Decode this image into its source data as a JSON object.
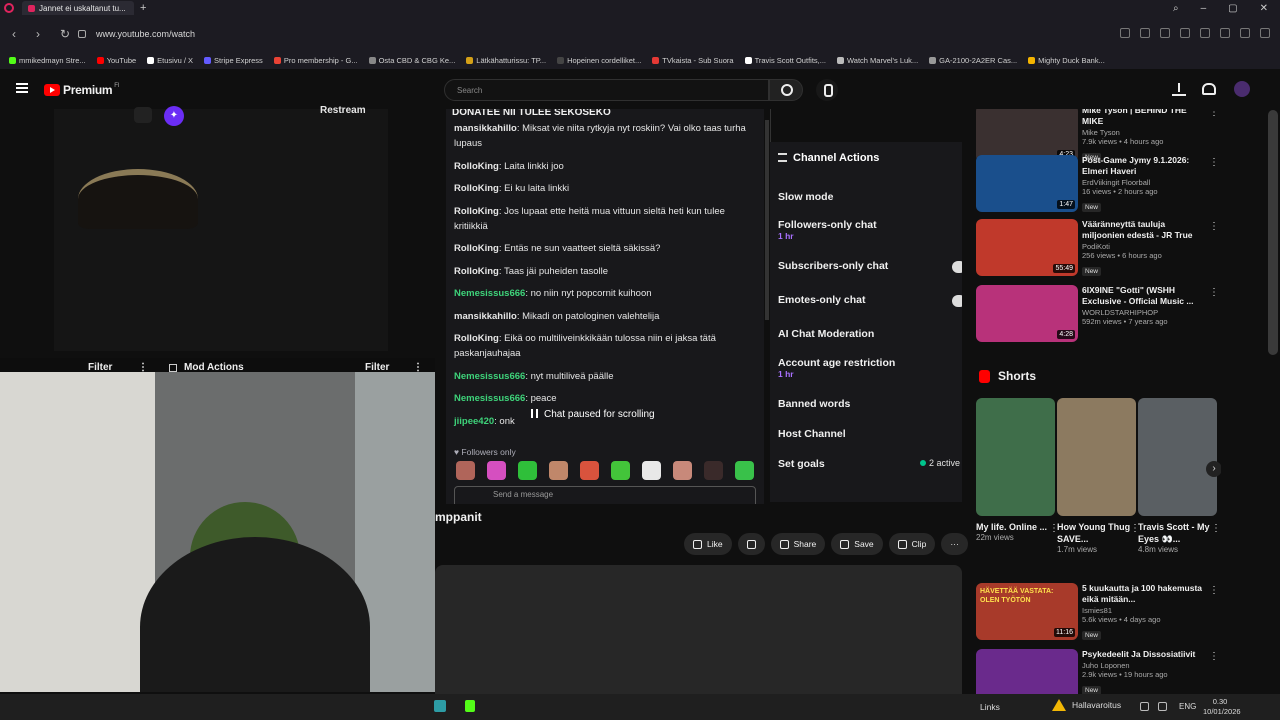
{
  "browser": {
    "tab_title": "Jannet ei uskaltanut tu...",
    "url": "www.youtube.com/watch",
    "bookmarks": [
      {
        "label": "mmikedmayn Stre...",
        "color": "#53fc18"
      },
      {
        "label": "YouTube",
        "color": "#ff0000"
      },
      {
        "label": "Etusivu / X",
        "color": "#ffffff"
      },
      {
        "label": "Stripe Express",
        "color": "#635bff"
      },
      {
        "label": "Pro membership - G...",
        "color": "#ea4335"
      },
      {
        "label": "Osta CBD & CBG Ke...",
        "color": "#888888"
      },
      {
        "label": "Lätkähatturissu: TP...",
        "color": "#d4a017"
      },
      {
        "label": "Hopeinen cordelliket...",
        "color": "#444444"
      },
      {
        "label": "TVkaista - Sub Suora",
        "color": "#e53935"
      },
      {
        "label": "Travis Scott Outfits,...",
        "color": "#ffffff"
      },
      {
        "label": "Watch Marvel's Luk...",
        "color": "#bbbbbb"
      },
      {
        "label": "GA-2100-2A2ER Cas...",
        "color": "#999999"
      },
      {
        "label": "Mighty Duck Bank...",
        "color": "#f4b400"
      }
    ]
  },
  "youtube": {
    "brand": "Premium",
    "country": "FI",
    "search_placeholder": "Search",
    "video_title": "mppanit",
    "actions": {
      "like": "Like",
      "share": "Share",
      "save": "Save",
      "clip": "Clip"
    }
  },
  "stream": {
    "restream_label": "Restream",
    "filter_left": "Filter",
    "mod_actions": "Mod Actions",
    "filter_right": "Filter"
  },
  "chat": {
    "title": "DONATEE NII TULEE SEKOSEKO",
    "messages": [
      {
        "user": "mansikkahillo",
        "color": "#e6e6e6",
        "text": ": Miksat vie niita rytkyja nyt roskiin? Vai olko taas turha lupaus"
      },
      {
        "user": "RolloKing",
        "color": "#e6e6e6",
        "text": ": Laita linkki joo"
      },
      {
        "user": "RolloKing",
        "color": "#e6e6e6",
        "text": ": Ei ku laita linkki"
      },
      {
        "user": "RolloKing",
        "color": "#e6e6e6",
        "text": ": Jos lupaat ette heitä mua vittuun sieltä heti kun tulee kritiikkiä"
      },
      {
        "user": "RolloKing",
        "color": "#e6e6e6",
        "text": ": Entäs ne sun vaatteet sieltä säkissä?"
      },
      {
        "user": "RolloKing",
        "color": "#e6e6e6",
        "text": ": Taas jäi puheiden tasolle"
      },
      {
        "user": "Nemesissus666",
        "color": "#3ed37a",
        "text": ": no niin nyt popcornit kuihoon"
      },
      {
        "user": "mansikkahillo",
        "color": "#e6e6e6",
        "text": ": Mikadi on patologinen valehtelija"
      },
      {
        "user": "RolloKing",
        "color": "#e6e6e6",
        "text": ": Eikä oo multiliveinkkikään tulossa niin ei jaksa tätä paskanjauhajaa"
      },
      {
        "user": "Nemesissus666",
        "color": "#3ed37a",
        "text": ": nyt multiliveä päälle"
      },
      {
        "user": "Nemesissus666",
        "color": "#3ed37a",
        "text": ": peace"
      },
      {
        "user": "jiipee420",
        "color": "#3ed37a",
        "text": ": onk"
      }
    ],
    "paused_label": "Chat paused for scrolling",
    "followers_label": "Followers only",
    "send_placeholder": "Send a message",
    "emote_colors": [
      "#b0655a",
      "#d54fc0",
      "#2fbf3a",
      "#c0876a",
      "#d9533d",
      "#43c43a",
      "#e8e8e8",
      "#c8897a",
      "#3a2a2a",
      "#39c14a"
    ]
  },
  "channel_actions": {
    "title": "Channel Actions",
    "items": [
      {
        "label": "Slow mode",
        "sub": ""
      },
      {
        "label": "Followers-only chat",
        "sub": "1 hr"
      },
      {
        "label": "Subscribers-only chat",
        "sub": ""
      },
      {
        "label": "Emotes-only chat",
        "sub": ""
      },
      {
        "label": "AI Chat Moderation",
        "sub": ""
      },
      {
        "label": "Account age restriction",
        "sub": "1 hr"
      },
      {
        "label": "Banned words",
        "sub": ""
      },
      {
        "label": "Host Channel",
        "sub": ""
      },
      {
        "label": "Set goals",
        "sub": ""
      }
    ],
    "active_label": "2 active"
  },
  "recommendations": [
    {
      "title": "Mike Tyson | BEHIND THE MIKE",
      "channel": "Mike Tyson",
      "views": "7.9k views • 4 hours ago",
      "badge": "New",
      "duration": "4:23",
      "color": "#3a3030"
    },
    {
      "title": "Post-Game Jymy 9.1.2026: Elmeri Haveri",
      "channel": "ErdViikingit Floorball",
      "views": "16 views • 2 hours ago",
      "badge": "New",
      "duration": "1:47",
      "color": "#1a4f8c"
    },
    {
      "title": "Vääränneyttä tauluja miljoonien edestä - JR True Crime - ...",
      "channel": "PodiKoti",
      "views": "256 views • 6 hours ago",
      "badge": "New",
      "duration": "55:49",
      "color": "#c0392b"
    },
    {
      "title": "6IX9INE \"Gotti\" (WSHH Exclusive - Official Music ...",
      "channel": "WORLDSTARHIPHOP",
      "views": "592m views • 7 years ago",
      "badge": "",
      "duration": "4:28",
      "color": "#b8327a"
    }
  ],
  "shorts": {
    "heading": "Shorts",
    "items": [
      {
        "title": "My life. Online ...",
        "views": "22m views",
        "color": "#3f6e4a"
      },
      {
        "title": "How Young Thug SAVE...",
        "views": "1.7m views",
        "color": "#8c7a60"
      },
      {
        "title": "Travis Scott - My Eyes 👀...",
        "views": "4.8m views",
        "color": "#5a5f63"
      }
    ]
  },
  "more_recs": [
    {
      "title": "5 kuukautta ja 100 hakemusta eikä mitään...",
      "channel": "Ismies81",
      "views": "5.6k views • 4 days ago",
      "badge": "New",
      "duration": "11:16",
      "color": "#a83a2a",
      "thumb_text": "HÄVETTÄÄ VASTATA: OLEN TYÖTÖN"
    },
    {
      "title": "Psykedeelit Ja Dissosiatiivit",
      "channel": "Juho Loponen",
      "views": "2.9k views • 19 hours ago",
      "badge": "New",
      "duration": "",
      "color": "#6a2a8c",
      "thumb_text": ""
    }
  ],
  "taskbar": {
    "links": "Links",
    "warning": "Hallavaroitus",
    "lang": "ENG",
    "time": "0.30",
    "date": "10/01/2026"
  }
}
